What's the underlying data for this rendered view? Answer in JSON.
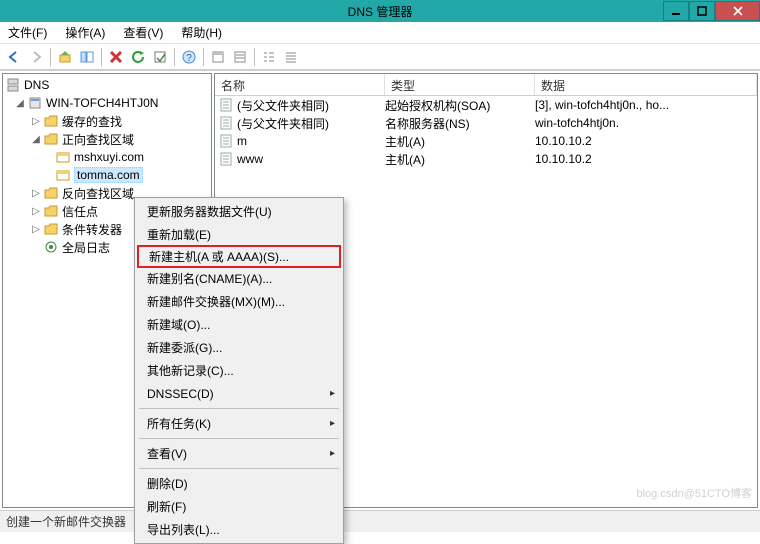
{
  "window": {
    "title": "DNS 管理器"
  },
  "menu": {
    "file": "文件(F)",
    "action": "操作(A)",
    "view": "查看(V)",
    "help": "帮助(H)"
  },
  "tree": {
    "root": "DNS",
    "server": "WIN-TOFCH4HTJ0N",
    "cached": "缓存的查找",
    "fwdzone": "正向查找区域",
    "zone1": "mshxuyi.com",
    "zone2": "tomma.com",
    "revzone": "反向查找区域",
    "trust": "信任点",
    "cond": "条件转发器",
    "global": "全局日志"
  },
  "columns": {
    "name": "名称",
    "type": "类型",
    "data": "数据"
  },
  "records": [
    {
      "name": "(与父文件夹相同)",
      "type": "起始授权机构(SOA)",
      "data": "[3], win-tofch4htj0n., ho..."
    },
    {
      "name": "(与父文件夹相同)",
      "type": "名称服务器(NS)",
      "data": "win-tofch4htj0n."
    },
    {
      "name": "m",
      "type": "主机(A)",
      "data": "10.10.10.2"
    },
    {
      "name": "www",
      "type": "主机(A)",
      "data": "10.10.10.2"
    }
  ],
  "context": {
    "updateServer": "更新服务器数据文件(U)",
    "reload": "重新加载(E)",
    "newHost": "新建主机(A 或 AAAA)(S)...",
    "newCname": "新建别名(CNAME)(A)...",
    "newMx": "新建邮件交换器(MX)(M)...",
    "newDomain": "新建域(O)...",
    "newDelegation": "新建委派(G)...",
    "otherNew": "其他新记录(C)...",
    "dnssec": "DNSSEC(D)",
    "allTasks": "所有任务(K)",
    "view": "查看(V)",
    "delete": "删除(D)",
    "refresh": "刷新(F)",
    "exportList": "导出列表(L)..."
  },
  "status": "创建一个新邮件交换器",
  "watermark": "blog.csdn@51CTO博客"
}
